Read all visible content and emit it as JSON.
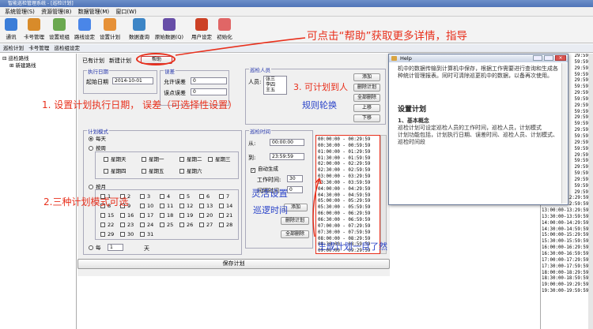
{
  "window": {
    "title": "智能巡检管理系统 - [巡检计划]"
  },
  "menu": [
    "系统管理(S)",
    "资源管理(B)",
    "数据管理(M)",
    "窗口(W)"
  ],
  "toolbar": [
    "通讯",
    "卡号管理",
    "设置班组",
    "路线设定",
    "设置计划",
    "数据查询",
    "原始数据(Q)",
    "用户设定",
    "初始化"
  ],
  "tabs": {
    "tab1": "巡检计划",
    "tab2": "卡号管理",
    "tab3": "巡检组设定"
  },
  "tree": {
    "root": "巡检路线",
    "child": "新建路线"
  },
  "plan_tabs": {
    "existing": "已有计划",
    "new": "新建计划",
    "help": "帮助"
  },
  "exec_date": {
    "group": "执行日期",
    "label": "起始日期",
    "value": "2014-10-01"
  },
  "error": {
    "group": "误差",
    "allow_label": "允许误差",
    "allow_value": "0",
    "point_label": "误点误差",
    "point_value": "0"
  },
  "inspectors": {
    "group": "巡检人员",
    "label": "人员:",
    "names": [
      "张三",
      "李四",
      "王五"
    ],
    "add": "添加",
    "delete": "删除计划",
    "clear": "全部删除",
    "up": "上移",
    "down": "下移"
  },
  "plan_mode": {
    "group": "计划模式",
    "daily": "每天",
    "weekly": "按周",
    "weekdays": [
      "星期天",
      "星期一",
      "星期二",
      "星期三",
      "星期四",
      "星期五",
      "星期六"
    ],
    "monthly": "按月",
    "days": [
      "1",
      "2",
      "3",
      "4",
      "5",
      "6",
      "7",
      "8",
      "9",
      "10",
      "11",
      "12",
      "13",
      "14",
      "15",
      "16",
      "17",
      "18",
      "19",
      "20",
      "21",
      "22",
      "23",
      "24",
      "25",
      "26",
      "27",
      "28",
      "29",
      "30",
      "31"
    ],
    "every": "每",
    "every_value": "1",
    "every_unit": "天"
  },
  "inspect_time": {
    "group": "巡检时间",
    "from_label": "从:",
    "from_value": "00:00:00",
    "to_label": "到:",
    "to_value": "23:59:59",
    "auto": "自动生成",
    "work_label": "工作时间:",
    "work_value": "30",
    "interval_label": "间隔时间",
    "interval_value": "0",
    "add": "添加",
    "delete": "删除计划",
    "clear": "全部删除"
  },
  "generated": [
    "00:00:00 - 00:29:59",
    "00:30:00 - 00:59:59",
    "01:00:00 - 01:29:59",
    "01:30:00 - 01:59:59",
    "02:00:00 - 02:29:59",
    "02:30:00 - 02:59:59",
    "03:00:00 - 03:29:59",
    "03:30:00 - 03:59:59",
    "04:00:00 - 04:29:59",
    "04:30:00 - 04:59:59",
    "05:00:00 - 05:29:59",
    "05:30:00 - 05:59:59",
    "06:00:00 - 06:29:59",
    "06:30:00 - 06:59:59",
    "07:00:00 - 07:29:59",
    "07:30:00 - 07:59:59",
    "08:00:00 - 08:29:59",
    "08:30:00 - 08:59:59",
    "09:00:00 - 09:29:59"
  ],
  "right_list": [
    "29:59",
    "59:59",
    "29:59",
    "59:59",
    "29:59",
    "59:59",
    "29:59",
    "59:59",
    "29:59",
    "59:59",
    "29:59",
    "59:59",
    "29:59",
    "59:59",
    "29:59",
    "59:59",
    "29:59",
    "59:59",
    "29:59",
    "59:59",
    "29:59",
    "59:59",
    "29:59",
    "12:00:00-12:29:59",
    "12:30:00-12:59:59",
    "13:00:00-13:29:59",
    "13:30:00-13:59:59",
    "14:00:00-14:29:59",
    "14:30:00-14:59:59",
    "15:00:00-15:29:59",
    "15:30:00-15:59:59",
    "16:00:00-16:29:59",
    "16:30:00-16:59:59",
    "17:00:00-17:29:59",
    "17:30:00-17:59:59",
    "18:00:00-18:29:59",
    "18:30:00-18:59:59",
    "19:00:00-19:29:59",
    "19:30:00-19:59:59"
  ],
  "save": "保存计划",
  "help_window": {
    "title": "Help",
    "intro": "机中的数据传输到计算机中保存，根据工作需要进行查询和生成各种统计管理报表。同时可清除巡更机中的数据，以备再次使用。",
    "heading": "设置计划",
    "sub": "1、基本概念",
    "body": "巡检计划可设定巡检人员的工作时间，巡检人员，计划模式",
    "body2": "计划功能包括，计划执行日期、误差时间、巡检人员、计划模式、巡检时间段"
  },
  "annotations": {
    "help": "可点击“帮助”获取更多详情，指导",
    "date": "1. 设置计划执行日期， 误差（可选择性设置）",
    "person": "3. 可计划到人",
    "rule": "规则轮换",
    "mode": "2.三种计划模式可选",
    "flex": "灵活设置",
    "time": "巡逻时间",
    "gen": "生成计划一目了然"
  },
  "colors": {
    "annotation": "#e8301c",
    "annotation_blue": "#2b44c9",
    "group_title": "#2233aa"
  }
}
